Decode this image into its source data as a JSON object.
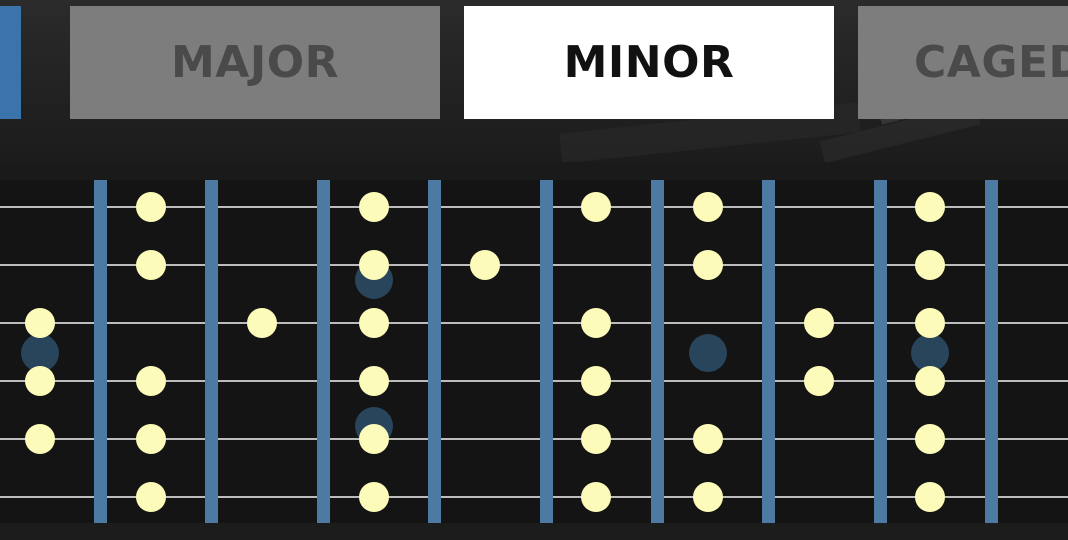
{
  "tabs": [
    {
      "label": "",
      "state": "active",
      "color": "#3a74ab"
    },
    {
      "label": "MAJOR",
      "state": "inactive",
      "color": "#7d7d7d"
    },
    {
      "label": "MINOR",
      "state": "selected",
      "color": "#ffffff"
    },
    {
      "label": "CAGED",
      "state": "inactive",
      "color": "#7d7d7d"
    }
  ],
  "fretboard": {
    "strings": 6,
    "fret_count_visible": 9,
    "colors": {
      "fret": "#4d7aa3",
      "string": "#bcbcbc",
      "note_dot": "#fdfbb9",
      "inlay_marker": "#2d4d69",
      "board": "#141414"
    },
    "note_positions": [
      {
        "string": 1,
        "position": 1
      },
      {
        "string": 1,
        "position": 3
      },
      {
        "string": 1,
        "position": 5
      },
      {
        "string": 1,
        "position": 6
      },
      {
        "string": 1,
        "position": 8
      },
      {
        "string": 2,
        "position": 1
      },
      {
        "string": 2,
        "position": 3
      },
      {
        "string": 2,
        "position": 4
      },
      {
        "string": 2,
        "position": 6
      },
      {
        "string": 2,
        "position": 8
      },
      {
        "string": 3,
        "position": 0
      },
      {
        "string": 3,
        "position": 2
      },
      {
        "string": 3,
        "position": 3
      },
      {
        "string": 3,
        "position": 5
      },
      {
        "string": 3,
        "position": 7
      },
      {
        "string": 3,
        "position": 8
      },
      {
        "string": 4,
        "position": 0
      },
      {
        "string": 4,
        "position": 1
      },
      {
        "string": 4,
        "position": 3
      },
      {
        "string": 4,
        "position": 5
      },
      {
        "string": 4,
        "position": 7
      },
      {
        "string": 4,
        "position": 8
      },
      {
        "string": 5,
        "position": 0
      },
      {
        "string": 5,
        "position": 1
      },
      {
        "string": 5,
        "position": 3
      },
      {
        "string": 5,
        "position": 5
      },
      {
        "string": 5,
        "position": 6
      },
      {
        "string": 5,
        "position": 8
      },
      {
        "string": 6,
        "position": 1
      },
      {
        "string": 6,
        "position": 3
      },
      {
        "string": 6,
        "position": 5
      },
      {
        "string": 6,
        "position": 6
      },
      {
        "string": 6,
        "position": 8
      }
    ],
    "inlay_markers": [
      {
        "type": "single",
        "position": 0
      },
      {
        "type": "double",
        "position": 3
      },
      {
        "type": "single",
        "position": 6
      },
      {
        "type": "single",
        "position": 8
      }
    ]
  }
}
